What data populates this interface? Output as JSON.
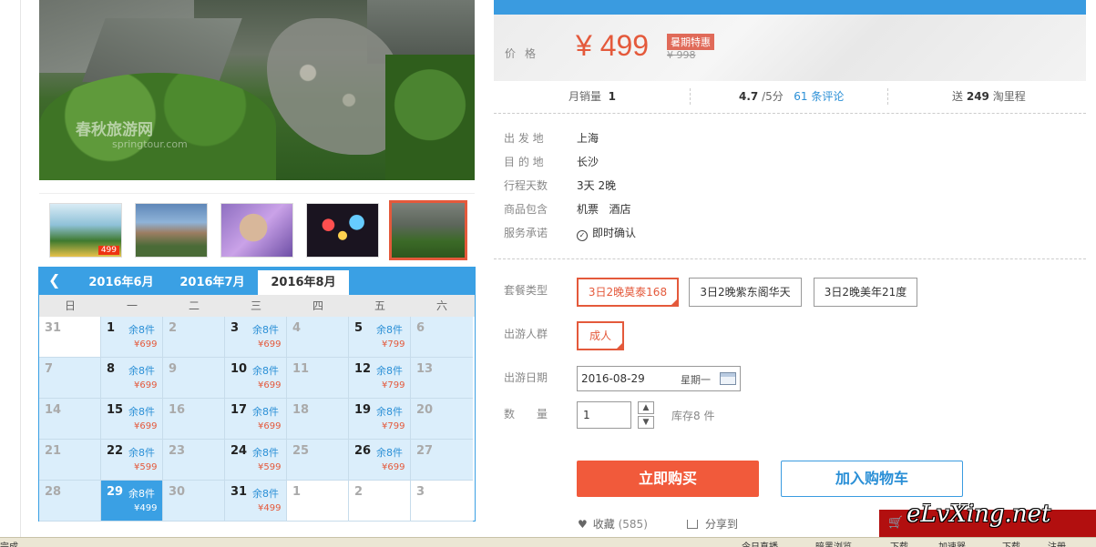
{
  "photo": {
    "watermark": "春秋旅游网",
    "watermark_url": "springtour.com"
  },
  "thumbnails": [
    {
      "name": "thumb-1",
      "badge": "499"
    },
    {
      "name": "thumb-2",
      "badge": ""
    },
    {
      "name": "thumb-3",
      "badge": ""
    },
    {
      "name": "thumb-4",
      "badge": ""
    },
    {
      "name": "thumb-5",
      "badge": ""
    }
  ],
  "calendar": {
    "prev_icon": "chevron-left-icon",
    "tabs": [
      "2016年6月",
      "2016年7月",
      "2016年8月"
    ],
    "active_tab": 2,
    "weekdays": [
      "日",
      "一",
      "二",
      "三",
      "四",
      "五",
      "六"
    ],
    "weeks": [
      [
        {
          "d": "31",
          "type": "muted"
        },
        {
          "d": "1",
          "s": "余8件",
          "p": "¥699"
        },
        {
          "d": "2",
          "type": "dim"
        },
        {
          "d": "3",
          "s": "余8件",
          "p": "¥699"
        },
        {
          "d": "4",
          "type": "dim"
        },
        {
          "d": "5",
          "s": "余8件",
          "p": "¥799"
        },
        {
          "d": "6",
          "type": "dim"
        }
      ],
      [
        {
          "d": "7",
          "type": "dim"
        },
        {
          "d": "8",
          "s": "余8件",
          "p": "¥699"
        },
        {
          "d": "9",
          "type": "dim"
        },
        {
          "d": "10",
          "s": "余8件",
          "p": "¥699"
        },
        {
          "d": "11",
          "type": "dim"
        },
        {
          "d": "12",
          "s": "余8件",
          "p": "¥799"
        },
        {
          "d": "13",
          "type": "dim"
        }
      ],
      [
        {
          "d": "14",
          "type": "dim"
        },
        {
          "d": "15",
          "s": "余8件",
          "p": "¥699"
        },
        {
          "d": "16",
          "type": "dim"
        },
        {
          "d": "17",
          "s": "余8件",
          "p": "¥699"
        },
        {
          "d": "18",
          "type": "dim"
        },
        {
          "d": "19",
          "s": "余8件",
          "p": "¥799"
        },
        {
          "d": "20",
          "type": "dim"
        }
      ],
      [
        {
          "d": "21",
          "type": "dim"
        },
        {
          "d": "22",
          "s": "余8件",
          "p": "¥599"
        },
        {
          "d": "23",
          "type": "dim"
        },
        {
          "d": "24",
          "s": "余8件",
          "p": "¥599"
        },
        {
          "d": "25",
          "type": "dim"
        },
        {
          "d": "26",
          "s": "余8件",
          "p": "¥699"
        },
        {
          "d": "27",
          "type": "dim"
        }
      ],
      [
        {
          "d": "28",
          "type": "dim"
        },
        {
          "d": "29",
          "s": "余8件",
          "p": "¥499",
          "type": "sel"
        },
        {
          "d": "30",
          "type": "dim"
        },
        {
          "d": "31",
          "s": "余8件",
          "p": "¥499"
        },
        {
          "d": "1",
          "type": "muted"
        },
        {
          "d": "2",
          "type": "muted"
        },
        {
          "d": "3",
          "type": "muted"
        }
      ]
    ]
  },
  "price": {
    "label": "价格",
    "current": "¥ 499",
    "tag": "暑期特惠",
    "original": "¥ 998"
  },
  "stats": {
    "monthly_sales_label": "月销量",
    "monthly_sales": "1",
    "rating": "4.7",
    "rating_suffix": "/5分",
    "reviews": "61 条评论",
    "miles_prefix": "送",
    "miles": "249",
    "miles_suffix": "淘里程"
  },
  "info": [
    {
      "label": "出 发 地",
      "value": "上海"
    },
    {
      "label": "目 的 地",
      "value": "长沙"
    },
    {
      "label": "行程天数",
      "value": "3天 2晚"
    },
    {
      "label": "商品包含",
      "value": "机票   酒店"
    },
    {
      "label": "服务承诺",
      "value": "即时确认"
    }
  ],
  "options": {
    "package_label": "套餐类型",
    "packages": [
      "3日2晚莫泰168",
      "3日2晚紫东阁华天",
      "3日2晚美年21度"
    ],
    "crowd_label": "出游人群",
    "crowd": "成人",
    "date_label": "出游日期",
    "date_value": "2016-08-29",
    "date_weekday": "星期一",
    "qty_label": "数　　量",
    "qty_value": "1",
    "stock": "库存8 件"
  },
  "actions": {
    "buy": "立即购买",
    "cart": "加入购物车",
    "fav_label": "收藏",
    "fav_count": "(585)",
    "share": "分享到"
  },
  "brand": {
    "text": "eLvXing.net"
  },
  "statusbar": [
    "完成",
    "今日直播",
    "暗黑浏览",
    "下载",
    "加速器",
    "下载",
    "注册"
  ],
  "colors": {
    "accent": "#e4593b",
    "blue": "#3aa0e4",
    "buy": "#f15a3b"
  }
}
